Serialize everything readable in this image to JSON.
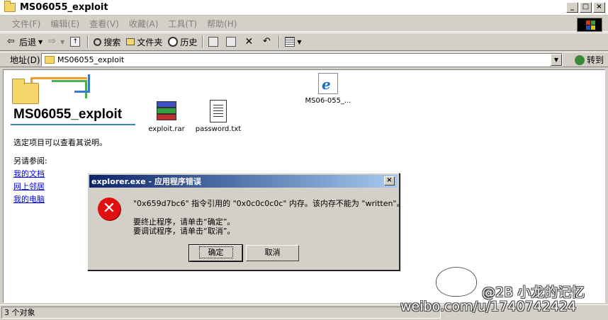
{
  "window": {
    "title": "MS06055_exploit",
    "buttons": [
      "_",
      "□",
      "×"
    ]
  },
  "menu": [
    "文件(F)",
    "编辑(E)",
    "查看(V)",
    "收藏(A)",
    "工具(T)",
    "帮助(H)"
  ],
  "toolbar": {
    "back": "后退",
    "search": "搜索",
    "folders": "文件夹",
    "history": "历史"
  },
  "address": {
    "label": "地址(D)",
    "value": "MS06055_exploit",
    "go": "转到"
  },
  "panel": {
    "title": "MS06055_exploit",
    "hint": "选定项目可以查看其说明。",
    "see_also": "另请参阅:",
    "links": [
      "我的文档",
      "网上邻居",
      "我的电脑"
    ]
  },
  "files": [
    {
      "name": "exploit.rar",
      "icon": "winrar-icon"
    },
    {
      "name": "password.txt",
      "icon": "text-file-icon"
    },
    {
      "name": "MS06-055_...",
      "icon": "ie-html-icon"
    }
  ],
  "dialog": {
    "title": "explorer.exe - 应用程序错误",
    "line1": "\"0x659d7bc6\" 指令引用的 \"0x0c0c0c0c\" 内存。该内存不能为 \"written\"。",
    "line2": "要终止程序，请单击“确定”。",
    "line3": "要调试程序，请单击“取消”。",
    "ok": "确定",
    "cancel": "取消"
  },
  "status": {
    "text": "3 个对象"
  },
  "watermark": {
    "line1": "@2B 小龙的记忆",
    "line2": "weibo.com/u/1740742424"
  }
}
